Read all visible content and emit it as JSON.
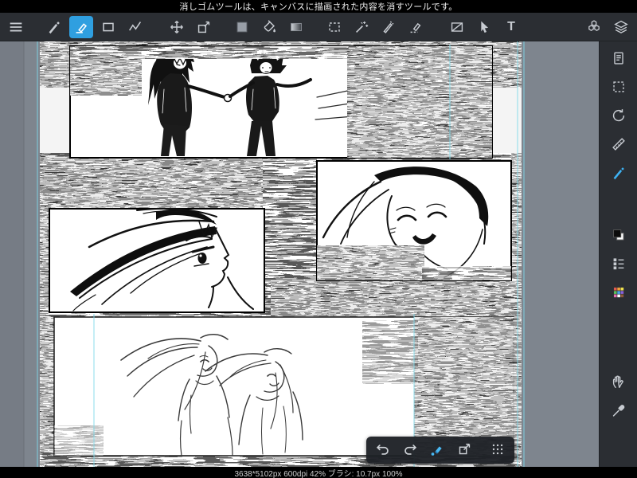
{
  "app": {
    "name": "paint-app",
    "accent_color": "#2f9fe0",
    "toolbar_bg": "#2b2e33",
    "canvas_bg": "#7e858e"
  },
  "top_bar": {
    "message": "消しゴムツールは、キャンバスに描画された内容を消すツールです。"
  },
  "toolbar": {
    "selected_tool": "eraser",
    "text_tool_glyph": "T",
    "tools": [
      {
        "id": "menu",
        "icon": "hamburger-menu-icon"
      },
      {
        "id": "brush",
        "icon": "brush-icon"
      },
      {
        "id": "eraser",
        "icon": "eraser-icon",
        "selected": true
      },
      {
        "id": "shape",
        "icon": "rectangle-icon"
      },
      {
        "id": "polyline",
        "icon": "polyline-icon"
      },
      {
        "id": "move",
        "icon": "move-arrows-icon"
      },
      {
        "id": "transform",
        "icon": "transform-icon"
      },
      {
        "id": "current-color",
        "icon": "color-swatch"
      },
      {
        "id": "fill",
        "icon": "paint-bucket-icon"
      },
      {
        "id": "gradient",
        "icon": "gradient-icon"
      },
      {
        "id": "select",
        "icon": "marquee-icon"
      },
      {
        "id": "magic-wand",
        "icon": "magic-wand-icon"
      },
      {
        "id": "select-pen",
        "icon": "select-pen-icon"
      },
      {
        "id": "select-eraser",
        "icon": "select-eraser-icon"
      },
      {
        "id": "panel-divide",
        "icon": "panel-divide-icon"
      },
      {
        "id": "operation",
        "icon": "cursor-icon"
      },
      {
        "id": "text",
        "icon": "text-icon"
      },
      {
        "id": "material",
        "icon": "material-hexagons-icon"
      },
      {
        "id": "layers",
        "icon": "layers-icon"
      }
    ]
  },
  "right_sidebar": {
    "selected": "brush-settings",
    "tools": [
      {
        "id": "pages",
        "icon": "pages-icon"
      },
      {
        "id": "selection",
        "icon": "selection-dashed-icon"
      },
      {
        "id": "rotate-reset",
        "icon": "rotate-icon"
      },
      {
        "id": "ruler",
        "icon": "ruler-icon"
      },
      {
        "id": "brush-settings",
        "icon": "brush-icon",
        "selected": true
      },
      {
        "id": "colors",
        "icon": "foreground-background-color-chips"
      },
      {
        "id": "layer-list",
        "icon": "layer-list-icon"
      },
      {
        "id": "palette",
        "icon": "color-palette-icon"
      },
      {
        "id": "hand",
        "icon": "hand-icon"
      },
      {
        "id": "eyedropper",
        "icon": "eyedropper-icon"
      }
    ]
  },
  "bottom_toolbar": {
    "tools": [
      {
        "id": "undo",
        "icon": "undo-arrow-icon"
      },
      {
        "id": "redo",
        "icon": "redo-arrow-icon"
      },
      {
        "id": "eraser-quick",
        "icon": "eraser-active-icon"
      },
      {
        "id": "transform-view",
        "icon": "open-transform-icon"
      },
      {
        "id": "drag-handle",
        "icon": "grid-dots-icon"
      }
    ]
  },
  "canvas": {
    "size": "3638*5102px",
    "dpi": "600dpi",
    "zoom": "42%",
    "brush_label": "ブラシ",
    "brush_size": "10.7px",
    "brush_opacity": "100%"
  },
  "status_bar": {
    "text": "3638*5102px 600dpi 42% ブラシ: 10.7px 100%"
  }
}
